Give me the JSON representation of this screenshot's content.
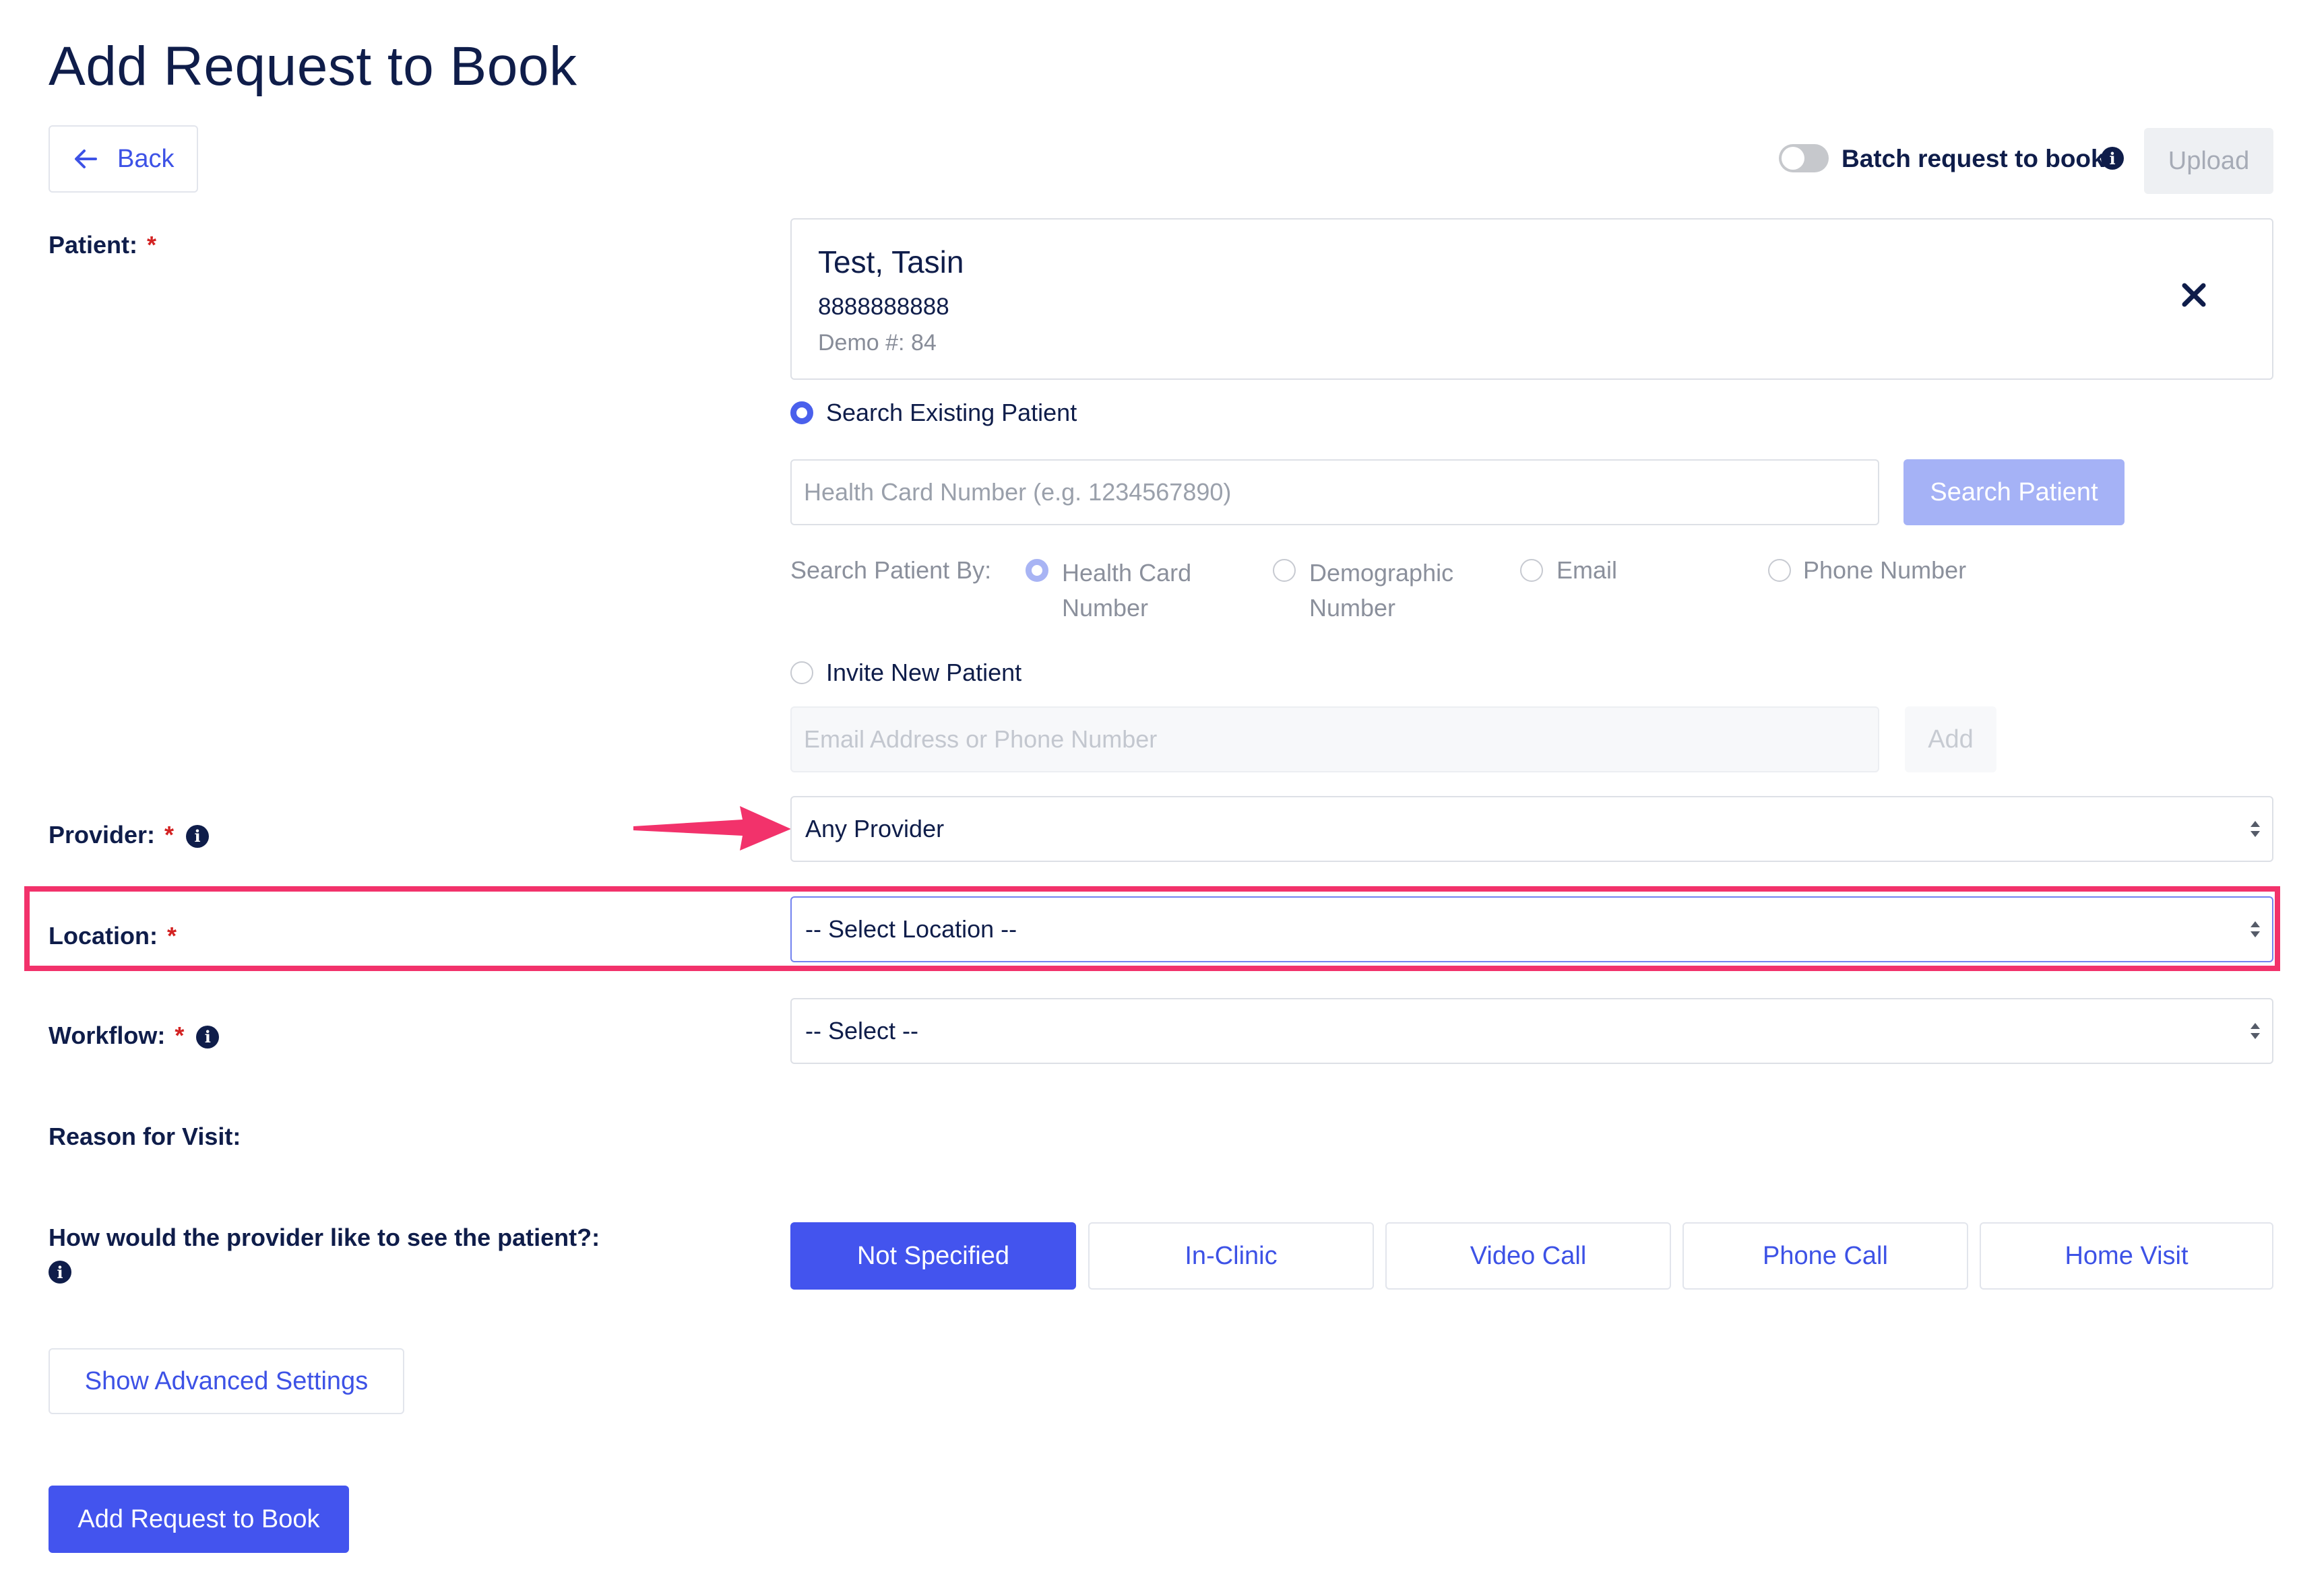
{
  "page": {
    "title": "Add Request to Book"
  },
  "header": {
    "back_label": "Back",
    "batch_label": "Batch request to book",
    "batch_enabled": false,
    "upload_label": "Upload"
  },
  "patient": {
    "label": "Patient:",
    "required_mark": "*",
    "name": "Test, Tasin",
    "phone": "8888888888",
    "demo": "Demo #: 84"
  },
  "search_existing": {
    "label": "Search Existing Patient",
    "selected": true,
    "input_placeholder": "Health Card Number (e.g. 1234567890)",
    "button_label": "Search Patient",
    "search_by_label": "Search Patient By:",
    "options": [
      {
        "line1": "Health Card",
        "line2": "Number",
        "selected": true
      },
      {
        "line1": "Demographic",
        "line2": "Number",
        "selected": false
      },
      {
        "line1": "Email",
        "line2": "",
        "selected": false
      },
      {
        "line1": "Phone Number",
        "line2": "",
        "selected": false
      }
    ]
  },
  "invite_new": {
    "label": "Invite New Patient",
    "selected": false,
    "input_placeholder": "Email Address or Phone Number",
    "button_label": "Add"
  },
  "provider": {
    "label": "Provider:",
    "required_mark": "*",
    "value": "Any Provider"
  },
  "location": {
    "label": "Location:",
    "required_mark": "*",
    "value": "-- Select Location --"
  },
  "workflow": {
    "label": "Workflow:",
    "required_mark": "*",
    "value": "-- Select --"
  },
  "reason": {
    "label": "Reason for Visit:"
  },
  "visit_mode": {
    "label": "How would the provider like to see the patient?:",
    "selected": "Not Specified",
    "options": [
      "Not Specified",
      "In-Clinic",
      "Video Call",
      "Phone Call",
      "Home Visit"
    ]
  },
  "advanced_label": "Show Advanced Settings",
  "submit_label": "Add Request to Book",
  "colors": {
    "accent": "#4354ee",
    "highlight": "#f2326b",
    "required": "#d32222",
    "text": "#0f1d4a"
  }
}
